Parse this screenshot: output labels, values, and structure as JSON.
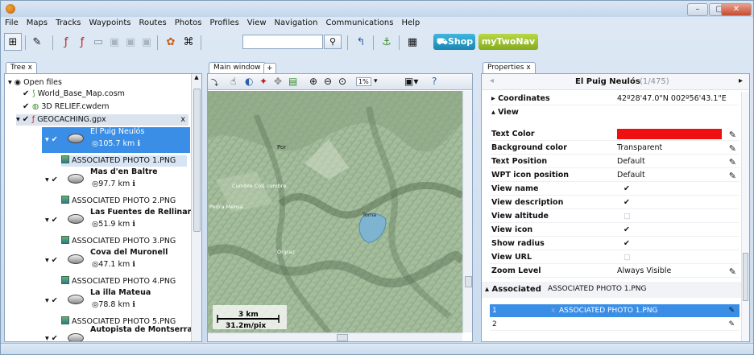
{
  "menu": [
    "File",
    "Maps",
    "Tracks",
    "Waypoints",
    "Routes",
    "Photos",
    "Profiles",
    "View",
    "Navigation",
    "Communications",
    "Help"
  ],
  "toolbar": {
    "shop_label": "Shop",
    "mytwonav_label": "myTwoNav",
    "search_value": ""
  },
  "tabs": {
    "tree": "Tree",
    "main": "Main window",
    "properties": "Properties"
  },
  "tree": {
    "root": "Open files",
    "items": [
      {
        "label": "World_Base_Map.cosm"
      },
      {
        "label": "3D RELIEF.cwdem"
      },
      {
        "label": "GEOCACHING.gpx"
      }
    ],
    "waypoints": [
      {
        "name": "El Puig Neulós",
        "dist": "105.7 km",
        "photo": "ASSOCIATED PHOTO 1.PNG"
      },
      {
        "name": "Mas d'en Baltre",
        "dist": "97.7 km",
        "photo": "ASSOCIATED PHOTO 2.PNG"
      },
      {
        "name": "Las Fuentes de Rellinars",
        "dist": "51.9 km",
        "photo": "ASSOCIATED PHOTO 3.PNG"
      },
      {
        "name": "Cova del Muronell",
        "dist": "47.1 km",
        "photo": "ASSOCIATED PHOTO 4.PNG"
      },
      {
        "name": "La illa Mateua",
        "dist": "78.8 km",
        "photo": "ASSOCIATED PHOTO 5.PNG"
      },
      {
        "name": "Autopista de Montserrat",
        "dist": "",
        "photo": ""
      }
    ],
    "close_x": "x"
  },
  "map": {
    "scale_km": "3 km",
    "scale_px": "31.2m/pix",
    "zoom_pct": "1%",
    "labels": [
      "Por",
      "Cumbre Coti cumbre",
      "Pedra Mensa",
      "Toma",
      "Orgraz"
    ]
  },
  "properties": {
    "title": "El Puig Neulós",
    "counter": "(1/475)",
    "coordinates_label": "Coordinates",
    "coordinates_value": "42º28'47.0\"N 002º56'43.1\"E",
    "view_section": "View",
    "rows": [
      {
        "key": "Text Color",
        "value": "",
        "color": "#ee1010",
        "edit": true
      },
      {
        "key": "Background color",
        "value": "Transparent",
        "edit": true
      },
      {
        "key": "Text Position",
        "value": "Default",
        "edit": true
      },
      {
        "key": "WPT icon position",
        "value": "Default",
        "edit": true
      },
      {
        "key": "View name",
        "check": true
      },
      {
        "key": "View description",
        "check": true
      },
      {
        "key": "View altitude",
        "check": false
      },
      {
        "key": "View icon",
        "check": true
      },
      {
        "key": "Show radius",
        "check": true
      },
      {
        "key": "View URL",
        "check": false
      },
      {
        "key": "Zoom Level",
        "value": "Always Visible",
        "edit": true
      }
    ],
    "associated_label": "Associated",
    "associated_value": "ASSOCIATED PHOTO 1.PNG",
    "list": [
      {
        "n": "1",
        "value": "ASSOCIATED PHOTO 1.PNG",
        "x": "x"
      },
      {
        "n": "2",
        "value": ""
      }
    ]
  }
}
